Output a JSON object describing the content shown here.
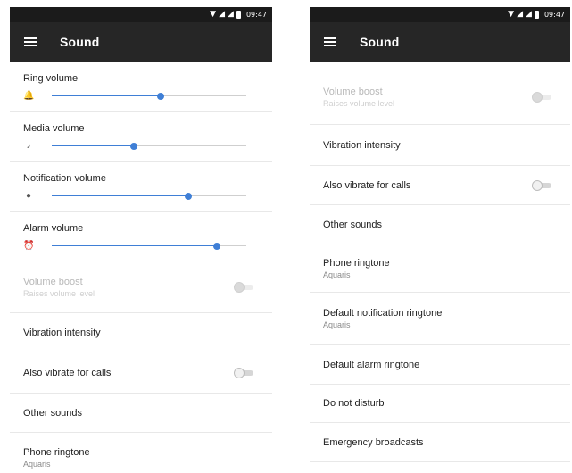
{
  "status": {
    "time": "09:47"
  },
  "appbar": {
    "title": "Sound"
  },
  "left": {
    "volumes": [
      {
        "label": "Ring volume",
        "icon": "bell-icon",
        "glyph": "🔔",
        "level": 0.56
      },
      {
        "label": "Media volume",
        "icon": "music-note-icon",
        "glyph": "♪",
        "level": 0.42
      },
      {
        "label": "Notification volume",
        "icon": "notification-icon",
        "glyph": "●",
        "level": 0.7
      },
      {
        "label": "Alarm volume",
        "icon": "alarm-clock-icon",
        "glyph": "⏰",
        "level": 0.85
      }
    ],
    "volume_boost": {
      "label": "Volume boost",
      "sub": "Raises volume level"
    },
    "vibration_intensity": {
      "label": "Vibration intensity"
    },
    "also_vibrate": {
      "label": "Also vibrate for calls"
    },
    "other_sounds": {
      "label": "Other sounds"
    },
    "phone_ringtone": {
      "label": "Phone ringtone",
      "sub": "Aquaris"
    }
  },
  "right": {
    "volume_boost": {
      "label": "Volume boost",
      "sub": "Raises volume level"
    },
    "vibration_intensity": {
      "label": "Vibration intensity"
    },
    "also_vibrate": {
      "label": "Also vibrate for calls"
    },
    "other_sounds": {
      "label": "Other sounds"
    },
    "phone_ringtone": {
      "label": "Phone ringtone",
      "sub": "Aquaris"
    },
    "default_notification": {
      "label": "Default notification ringtone",
      "sub": "Aquaris"
    },
    "default_alarm": {
      "label": "Default alarm ringtone"
    },
    "do_not_disturb": {
      "label": "Do not disturb"
    },
    "emergency": {
      "label": "Emergency broadcasts"
    }
  }
}
